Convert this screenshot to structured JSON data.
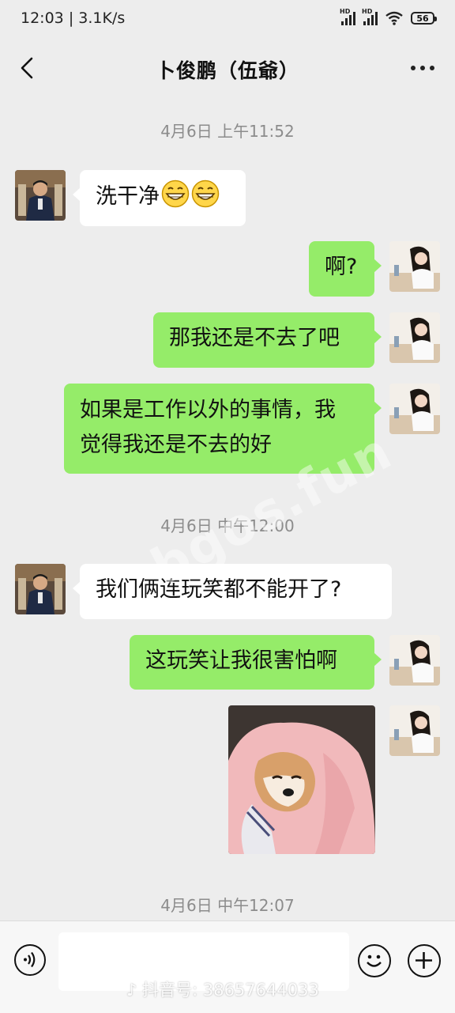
{
  "status": {
    "time": "12:03",
    "separator": "|",
    "speed": "3.1K/s",
    "battery": "56"
  },
  "header": {
    "title": "卜俊鹏（伍爺）"
  },
  "messages": {
    "time1": "4月6日 上午11:52",
    "m1": "洗干净",
    "m2": "啊?",
    "m3": "那我还是不去了吧",
    "m4a": "如果是工作以外的事情，我",
    "m4b": "觉得我还是不去的好",
    "time2": "4月6日 中午12:00",
    "m5": "我们俩连玩笑都不能开了?",
    "m6": "这玩笑让我很害怕啊",
    "time3": "4月6日 中午12:07"
  },
  "watermark": "bgos.fun",
  "input": {
    "placeholder": ""
  },
  "footer": {
    "douyin": "抖音号: 38657644033"
  },
  "colors": {
    "background": "#ededed",
    "self_bubble": "#95ec69",
    "other_bubble": "#ffffff",
    "timestamp": "#8c8c8c"
  },
  "icons": [
    "back-arrow-icon",
    "more-icon",
    "voice-icon",
    "emoji-icon",
    "add-icon",
    "grinning-emoji-icon",
    "douyin-logo-icon"
  ]
}
